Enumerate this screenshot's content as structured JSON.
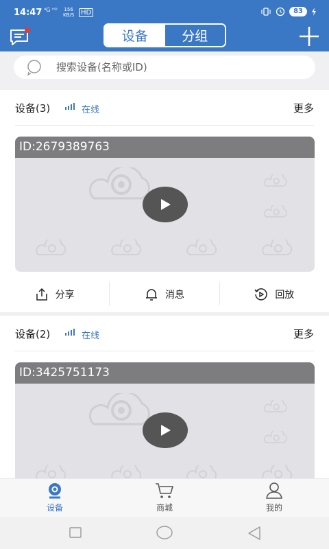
{
  "status_bar": {
    "time": "14:47",
    "net": "⁴G ᴴᴰ",
    "speed_top": "156",
    "speed_bottom": "KB/S",
    "hd": "HD",
    "battery": "83"
  },
  "header": {
    "tabs": [
      {
        "label": "设备",
        "active": true
      },
      {
        "label": "分组",
        "active": false
      }
    ]
  },
  "search": {
    "placeholder": "搜索设备(名称或ID)"
  },
  "devices": [
    {
      "title": "设备(3)",
      "status": "在线",
      "more": "更多",
      "id_text": "ID:2679389763"
    },
    {
      "title": "设备(2)",
      "status": "在线",
      "more": "更多",
      "id_text": "ID:3425751173"
    }
  ],
  "actions": {
    "share": "分享",
    "messages": "消息",
    "playback": "回放"
  },
  "bottom_nav": [
    {
      "label": "设备",
      "active": true
    },
    {
      "label": "商城",
      "active": false
    },
    {
      "label": "我的",
      "active": false
    }
  ],
  "colors": {
    "primary": "#3a78c5",
    "notification": "#e53935",
    "online": "#3a78c5"
  },
  "icons": [
    "chat-notification-icon",
    "plus-icon",
    "search-icon",
    "signal-icon",
    "play-icon",
    "share-icon",
    "bell-icon",
    "playback-icon",
    "camera-icon",
    "cart-icon",
    "user-icon"
  ]
}
